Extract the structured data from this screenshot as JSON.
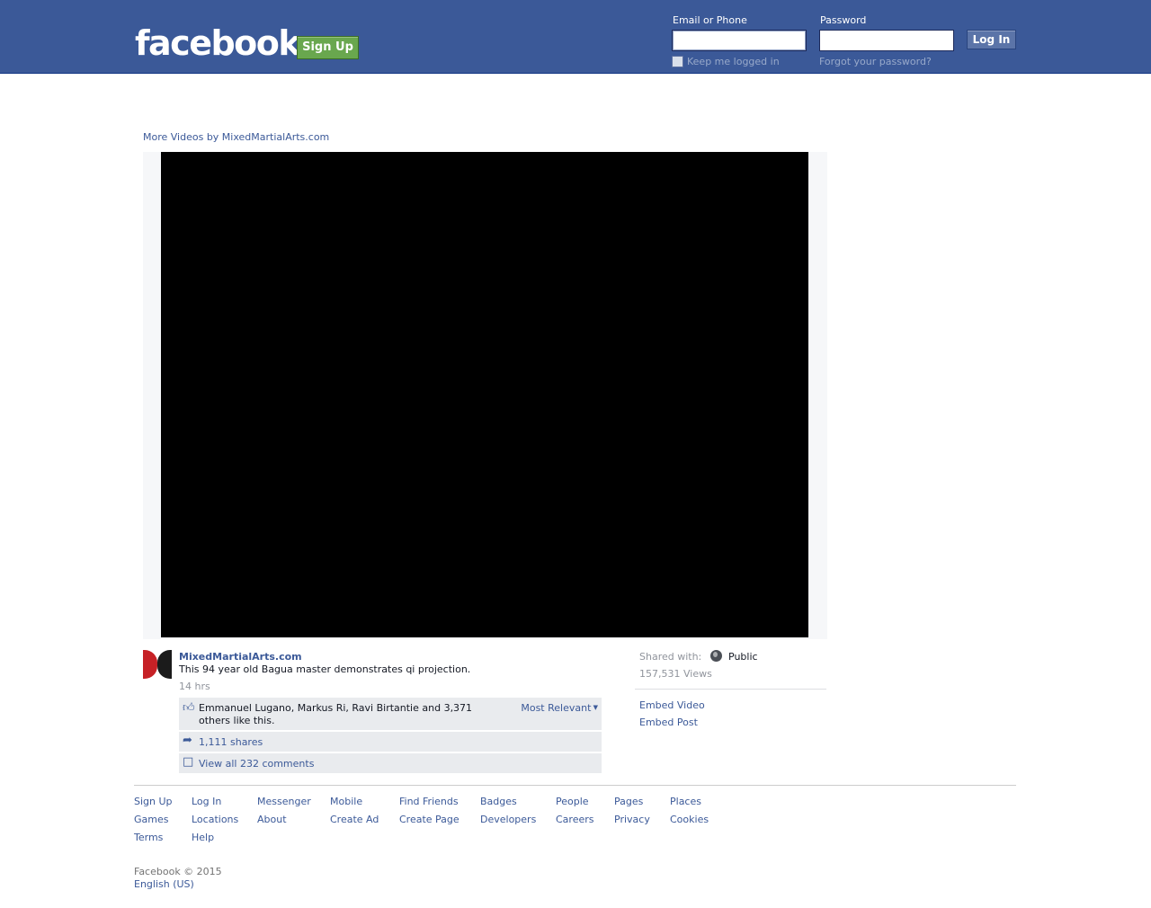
{
  "header": {
    "logo": "facebook",
    "signup_label": "Sign Up",
    "email_label": "Email or Phone",
    "password_label": "Password",
    "email_value": "",
    "password_value": "",
    "login_label": "Log In",
    "keep_logged_in": "Keep me logged in",
    "forgot_password": "Forgot your password?"
  },
  "content": {
    "more_videos": "More Videos by MixedMartialArts.com",
    "page_name": "MixedMartialArts.com",
    "description": "This 94 year old Bagua master demonstrates qi projection.",
    "time": "14 hrs",
    "likes_text": "Emmanuel Lugano, Markus Ri, Ravi Birtantie and 3,371 others like this.",
    "most_relevant": "Most Relevant",
    "shares": "1,111 shares",
    "comments": "View all 232 comments"
  },
  "side": {
    "shared_with_label": "Shared with:",
    "shared_with_value": "Public",
    "views": "157,531 Views",
    "embed_video": "Embed Video",
    "embed_post": "Embed Post"
  },
  "footer": {
    "links": {
      "signup": "Sign Up",
      "login": "Log In",
      "messenger": "Messenger",
      "mobile": "Mobile",
      "find_friends": "Find Friends",
      "badges": "Badges",
      "people": "People",
      "pages": "Pages",
      "places": "Places",
      "games": "Games",
      "locations": "Locations",
      "about": "About",
      "create_ad": "Create Ad",
      "create_page": "Create Page",
      "developers": "Developers",
      "careers": "Careers",
      "privacy": "Privacy",
      "cookies": "Cookies",
      "terms": "Terms",
      "help": "Help"
    },
    "copyright": "Facebook © 2015",
    "language": "English (US)"
  },
  "colors": {
    "brand_blue": "#3b5998",
    "signup_green": "#69a74e",
    "video_bg": "#000000"
  }
}
